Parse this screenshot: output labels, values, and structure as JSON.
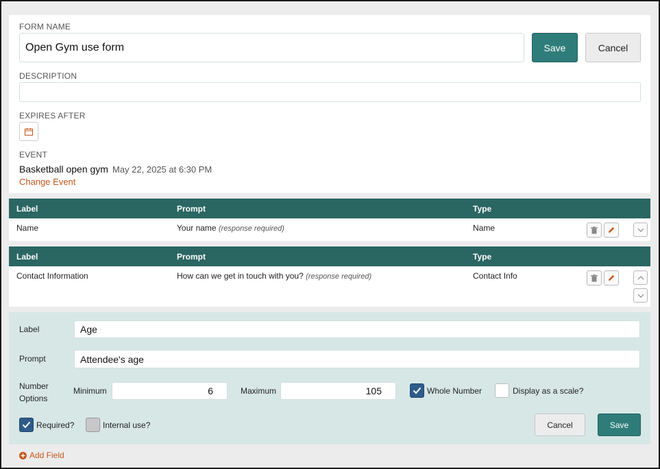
{
  "form": {
    "name_label": "FORM NAME",
    "name_value": "Open Gym use form",
    "save_label": "Save",
    "cancel_label": "Cancel",
    "description_label": "DESCRIPTION",
    "description_value": "",
    "expires_label": "EXPIRES AFTER",
    "event_label": "EVENT",
    "event_name": "Basketball open gym",
    "event_date": "May 22, 2025 at 6:30 PM",
    "change_event_label": "Change Event"
  },
  "fields": [
    {
      "header": {
        "label": "Label",
        "prompt": "Prompt",
        "type": "Type"
      },
      "label": "Name",
      "prompt": "Your name",
      "required_note": "(response required)",
      "type": "Name"
    },
    {
      "header": {
        "label": "Label",
        "prompt": "Prompt",
        "type": "Type"
      },
      "label": "Contact Information",
      "prompt": "How can we get in touch with you?",
      "required_note": "(response required)",
      "type": "Contact Info"
    }
  ],
  "editor": {
    "label_caption": "Label",
    "label_value": "Age",
    "prompt_caption": "Prompt",
    "prompt_value": "Attendee's age",
    "number_options_line1": "Number",
    "number_options_line2": "Options",
    "minimum_label": "Minimum",
    "minimum_value": "6",
    "maximum_label": "Maximum",
    "maximum_value": "105",
    "whole_number_label": "Whole Number",
    "whole_number_checked": true,
    "scale_label": "Display as a scale?",
    "scale_checked": false,
    "required_label": "Required?",
    "required_checked": true,
    "internal_label": "Internal use?",
    "internal_checked": false,
    "cancel_label": "Cancel",
    "save_label": "Save"
  },
  "add_field_label": "Add Field",
  "colors": {
    "teal_header": "#2a6662",
    "primary_button": "#2e7d7a",
    "accent_orange": "#c4561a",
    "editor_bg": "#d7e7e6",
    "checkbox_blue": "#2d5c8a"
  }
}
